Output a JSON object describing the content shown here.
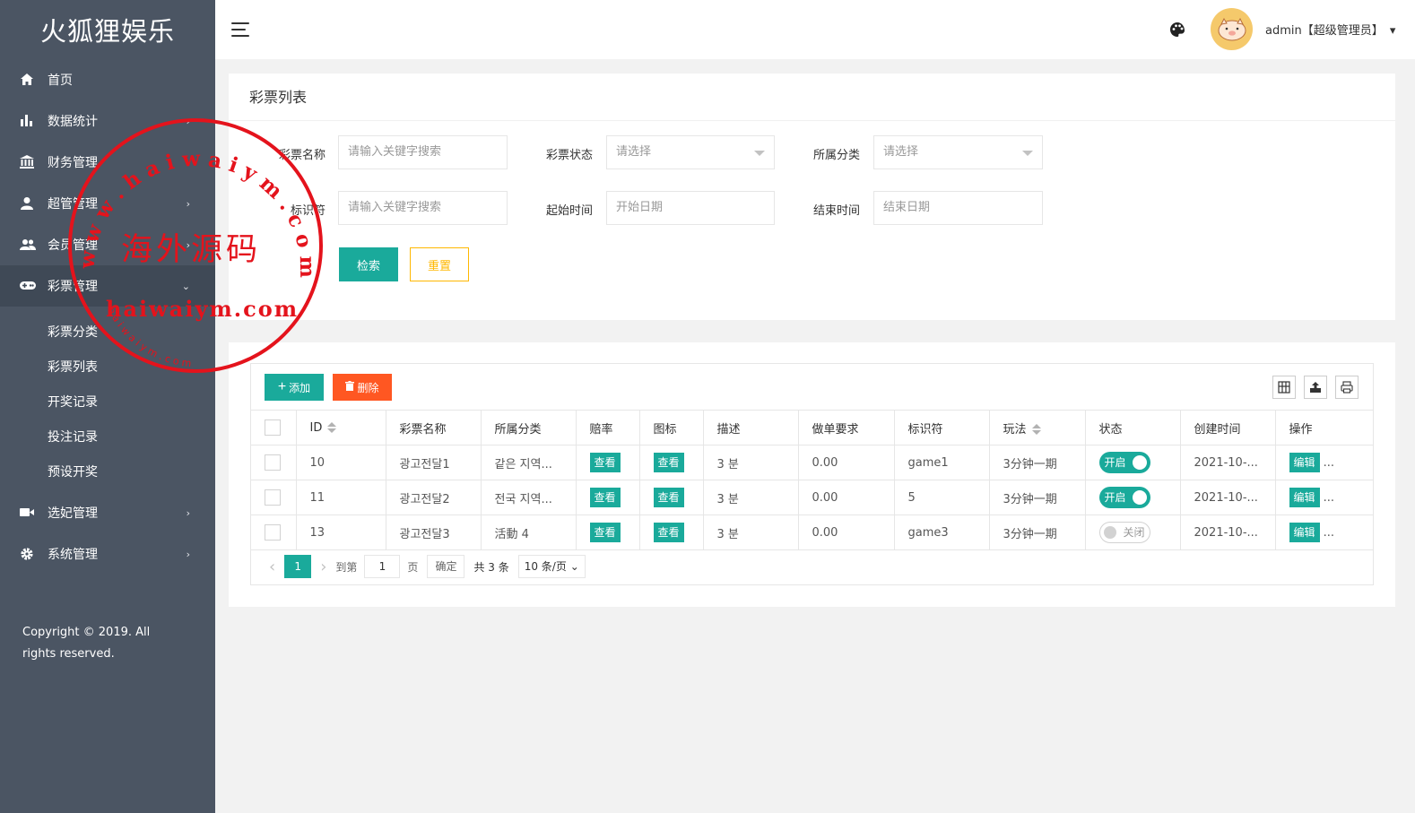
{
  "app": {
    "logo": "火狐狸娱乐"
  },
  "sidebar": {
    "items": [
      {
        "label": "首页",
        "icon": "home-icon",
        "arrow": ""
      },
      {
        "label": "数据统计",
        "icon": "bar-chart-icon",
        "arrow": "›"
      },
      {
        "label": "财务管理",
        "icon": "bank-icon",
        "arrow": "›"
      },
      {
        "label": "超管管理",
        "icon": "user-icon",
        "arrow": "›"
      },
      {
        "label": "会员管理",
        "icon": "users-icon",
        "arrow": "›"
      },
      {
        "label": "彩票管理",
        "icon": "gamepad-icon",
        "arrow": "⌄"
      }
    ],
    "subitems": [
      {
        "label": "彩票分类"
      },
      {
        "label": "彩票列表"
      },
      {
        "label": "开奖记录"
      },
      {
        "label": "投注记录"
      },
      {
        "label": "预设开奖"
      }
    ],
    "items2": [
      {
        "label": "选妃管理",
        "icon": "video-icon",
        "arrow": "›"
      },
      {
        "label": "系统管理",
        "icon": "gear-icon",
        "arrow": "›"
      }
    ],
    "copyright": "Copyright © 2019. All rights reserved."
  },
  "header": {
    "user": "admin【超级管理员】",
    "dropdown": "▾"
  },
  "search_panel": {
    "title": "彩票列表",
    "fields": {
      "name_label": "彩票名称",
      "name_placeholder": "请输入关键字搜索",
      "status_label": "彩票状态",
      "status_placeholder": "请选择",
      "category_label": "所属分类",
      "category_placeholder": "请选择",
      "key_label": "标识符",
      "key_placeholder": "请输入关键字搜索",
      "start_label": "起始时间",
      "start_placeholder": "开始日期",
      "end_label": "结束时间",
      "end_placeholder": "结束日期"
    },
    "search_button": "检索",
    "reset_button": "重置"
  },
  "table_panel": {
    "add_button": "添加",
    "delete_button": "删除",
    "columns": [
      "ID",
      "彩票名称",
      "所属分类",
      "赔率",
      "图标",
      "描述",
      "做单要求",
      "标识符",
      "玩法",
      "状态",
      "创建时间",
      "操作"
    ],
    "view_label": "查看",
    "edit_label": "编辑",
    "more_label": "...",
    "rows": [
      {
        "id": "10",
        "name": "광고전달1",
        "category": "같은 지역...",
        "desc": "3 분",
        "req": "0.00",
        "key": "game1",
        "play": "3分钟一期",
        "status": "开启",
        "status_on": true,
        "created": "2021-10-..."
      },
      {
        "id": "11",
        "name": "광고전달2",
        "category": "전국 지역...",
        "desc": "3 분",
        "req": "0.00",
        "key": "5",
        "play": "3分钟一期",
        "status": "开启",
        "status_on": true,
        "created": "2021-10-..."
      },
      {
        "id": "13",
        "name": "광고전달3",
        "category": "活動 4",
        "desc": "3 분",
        "req": "0.00",
        "key": "game3",
        "play": "3分钟一期",
        "status": "关闭",
        "status_on": false,
        "created": "2021-10-..."
      }
    ],
    "pager": {
      "prev": "‹",
      "current": "1",
      "next": "›",
      "goto_label": "到第",
      "goto_value": "1",
      "page_label": "页",
      "confirm": "确定",
      "total": "共 3 条",
      "per_page": "10 条/页"
    }
  },
  "watermark": {
    "center": "海外源码",
    "url": "haiwaiym.com",
    "arc_top": "w w w . h a i w a i y m . c o m",
    "arc_bottom": "h a i w a i y m . c o m"
  },
  "colors": {
    "sidebar": "#4b5563",
    "primary": "#1aaa9b",
    "danger": "#ff5722",
    "warning": "#ffb800",
    "stamp": "#e4131c"
  }
}
